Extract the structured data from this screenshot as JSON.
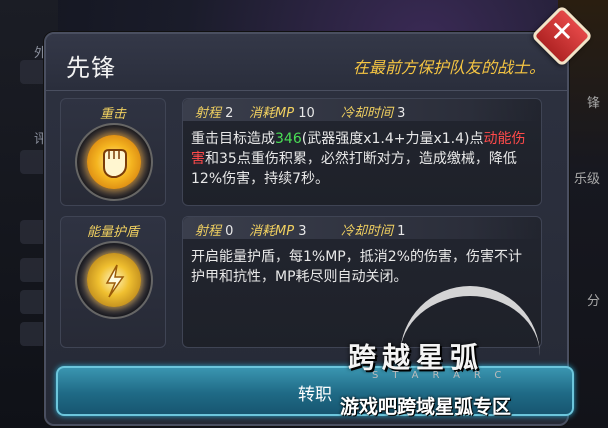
{
  "background": {
    "left_labels": [
      "外",
      "评"
    ],
    "right_labels": [
      "锋",
      "乐级",
      "分"
    ]
  },
  "panel": {
    "class_name": "先锋",
    "class_description": "在最前方保护队友的战士。",
    "close_symbol": "✕"
  },
  "skills": [
    {
      "name": "重击",
      "icon": "fist-icon",
      "range_label": "射程",
      "range_value": "2",
      "mp_label": "消耗MP",
      "mp_value": "10",
      "cooldown_label": "冷却时间",
      "cooldown_value": "3",
      "text_part1": "重击目标造成",
      "damage_value": "346",
      "text_part2": "(武器强度x1.4+力量x1.4)点",
      "damage_type": "动能伤害",
      "text_part3": "和35点重伤积累，必然打断对方，造成缴械，降低12%伤害，持续7秒。"
    },
    {
      "name": "能量护盾",
      "icon": "energy-shield-icon",
      "range_label": "射程",
      "range_value": "0",
      "mp_label": "消耗MP",
      "mp_value": "3",
      "cooldown_label": "冷却时间",
      "cooldown_value": "1",
      "text": "开启能量护盾，每1%MP，抵消2%的伤害，伤害不计护甲和抗性，MP耗尽则自动关闭。"
    }
  ],
  "confirm_button": "转职",
  "logo": {
    "title": "跨越星弧",
    "subtitle": "STARARC"
  },
  "watermark": "游戏吧跨域星弧专区",
  "colors": {
    "accent_gold": "#f0d060",
    "highlight_green": "#4ade55",
    "highlight_red": "#ff4a4a",
    "button_blue": "#1f6a86"
  }
}
